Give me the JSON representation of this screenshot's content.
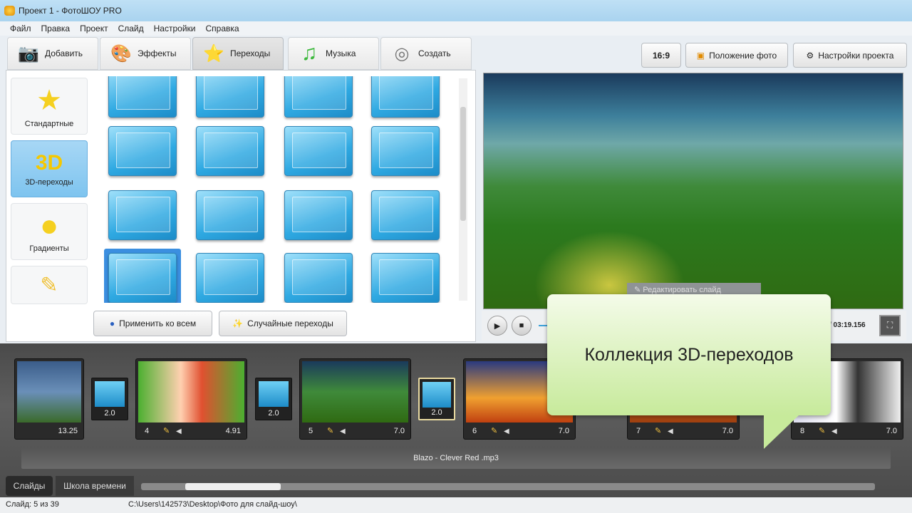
{
  "window": {
    "title": "Проект 1 - ФотоШОУ PRO"
  },
  "menu": [
    "Файл",
    "Правка",
    "Проект",
    "Слайд",
    "Настройки",
    "Справка"
  ],
  "tabs": [
    {
      "label": "Добавить",
      "icon": "📷"
    },
    {
      "label": "Эффекты",
      "icon": "🎨"
    },
    {
      "label": "Переходы",
      "icon": "⭐"
    },
    {
      "label": "Музыка",
      "icon": "♫"
    },
    {
      "label": "Создать",
      "icon": "◎"
    }
  ],
  "toolbar": {
    "aspect": "16:9",
    "photo_position": "Положение фото",
    "project_settings": "Настройки проекта"
  },
  "categories": [
    {
      "label": "Стандартные",
      "icon": "★"
    },
    {
      "label": "3D-переходы",
      "icon": "3D"
    },
    {
      "label": "Градиенты",
      "icon": "●"
    },
    {
      "label": "",
      "icon": "✎"
    }
  ],
  "transitions_count": 16,
  "buttons": {
    "apply_all": "Применить ко всем",
    "random": "Случайные переходы"
  },
  "player": {
    "time": "/ 03:19.156",
    "popup": "Редактировать слайд"
  },
  "slides": [
    {
      "num": "",
      "dur": "13.25"
    },
    {
      "num": "4",
      "dur": "4.91"
    },
    {
      "num": "5",
      "dur": "7.0"
    },
    {
      "num": "6",
      "dur": "7.0"
    },
    {
      "num": "7",
      "dur": "7.0"
    },
    {
      "num": "8",
      "dur": "7.0"
    }
  ],
  "transitions": [
    "2.0",
    "2.0",
    "2.0"
  ],
  "audio": "Blazo - Clever Red .mp3",
  "bottom_tabs": {
    "slides": "Слайды",
    "timeline": "Школа времени"
  },
  "status": {
    "slide": "Слайд: 5 из 39",
    "path": "C:\\Users\\142573\\Desktop\\Фото для слайд-шоу\\"
  },
  "callout": "Коллекция 3D-переходов"
}
